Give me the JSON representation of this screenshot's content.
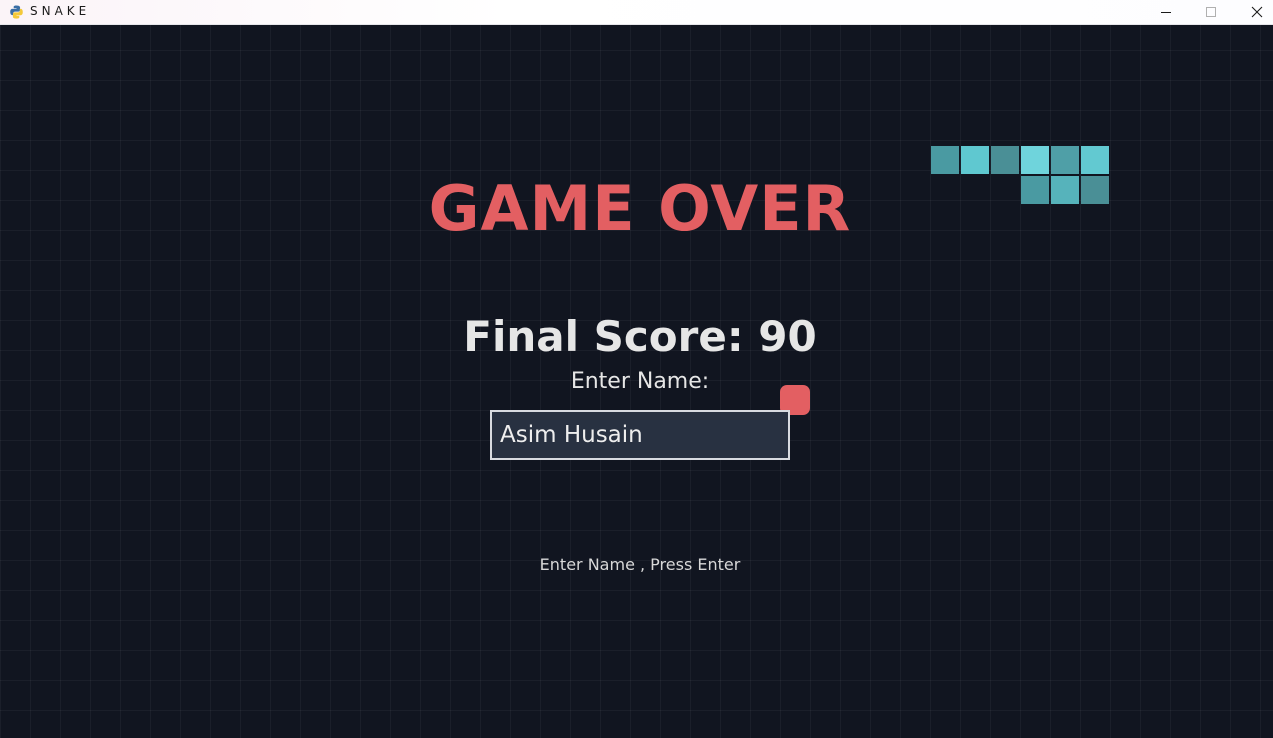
{
  "window": {
    "title": "SNAKE",
    "icon": "python-icon",
    "controls": [
      "minimize-icon",
      "maximize-icon",
      "close-icon"
    ]
  },
  "game": {
    "heading": "GAME OVER",
    "final_score_label": "Final Score: 90",
    "final_score": 90,
    "name_prompt": "Enter Name:",
    "name_value": "Asim Husain",
    "hint": "Enter Name , Press Enter"
  },
  "colors": {
    "background": "#111520",
    "accent_red": "#e35f62",
    "snake_light": "#5fc8d0",
    "snake_dark": "#4a9aa2",
    "text": "#e6e6e6",
    "input_bg": "#283141"
  }
}
